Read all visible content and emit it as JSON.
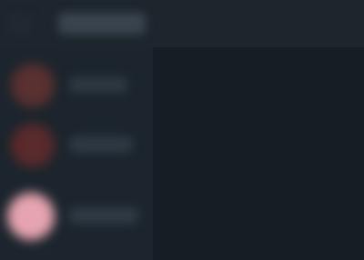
{
  "header": {
    "title": ""
  },
  "list": {
    "items": [
      {
        "label": "",
        "avatar_color": "#5a3030"
      },
      {
        "label": "",
        "avatar_color": "#5a2a2c"
      },
      {
        "label": "",
        "avatar_color": "#e5a4b0"
      }
    ]
  },
  "colors": {
    "background": "#161c24",
    "header": "#1d252d",
    "sidebar": "#1c252d"
  }
}
